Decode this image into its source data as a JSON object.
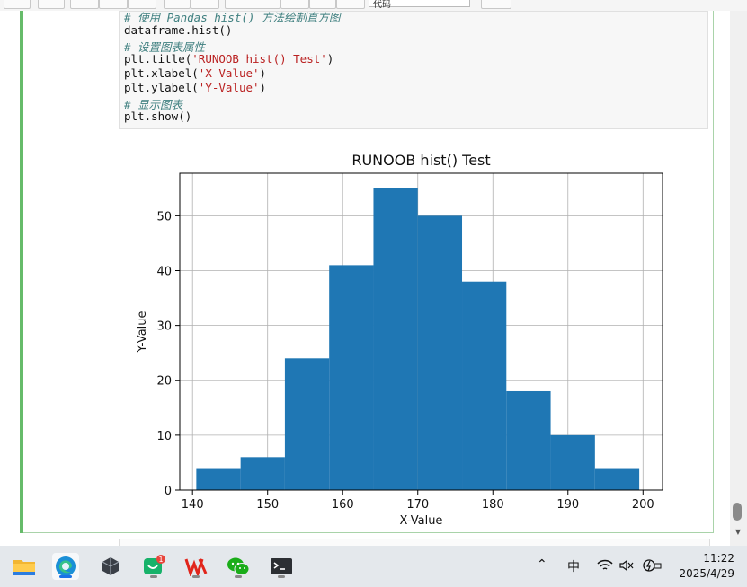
{
  "toolbar": {
    "buttons": [
      "",
      "",
      "",
      "",
      "",
      "",
      "",
      "",
      "",
      "",
      "",
      "",
      "",
      ""
    ],
    "cell_type_select": "代码"
  },
  "code": [
    {
      "kind": "comment",
      "text": "# 使用 Pandas hist() 方法绘制直方图"
    },
    {
      "kind": "plain",
      "text": "dataframe.hist()"
    },
    {
      "kind": "comment",
      "text": "# 设置图表属性"
    },
    {
      "kind": "call",
      "pre": "plt.title(",
      "str": "'RUNOOB hist() Test'",
      "post": ")"
    },
    {
      "kind": "call",
      "pre": "plt.xlabel(",
      "str": "'X-Value'",
      "post": ")"
    },
    {
      "kind": "call",
      "pre": "plt.ylabel(",
      "str": "'Y-Value'",
      "post": ")"
    },
    {
      "kind": "comment",
      "text": "# 显示图表"
    },
    {
      "kind": "plain",
      "text": "plt.show()"
    }
  ],
  "chart_data": {
    "type": "bar",
    "title": "RUNOOB hist() Test",
    "xlabel": "X-Value",
    "ylabel": "Y-Value",
    "bin_edges": [
      140.5,
      146.4,
      152.3,
      158.2,
      164.1,
      170.0,
      175.9,
      181.8,
      187.7,
      193.6,
      199.5
    ],
    "values": [
      4,
      6,
      24,
      41,
      55,
      50,
      38,
      18,
      10,
      4
    ],
    "xlim": [
      138.3,
      202.6
    ],
    "ylim": [
      0,
      57.75
    ],
    "xticks": [
      140,
      150,
      160,
      170,
      180,
      190,
      200
    ],
    "yticks": [
      0,
      10,
      20,
      30,
      40,
      50
    ],
    "grid": true,
    "bar_color": "#1f77b4"
  },
  "taskbar": {
    "apps": [
      "file-explorer-icon",
      "edge-icon",
      "app-icon",
      "chat-icon",
      "wps-icon",
      "wechat-icon",
      "terminal-icon"
    ],
    "chat_badge": "1",
    "ime": "中",
    "time": "11:22",
    "date": "2025/4/29"
  }
}
